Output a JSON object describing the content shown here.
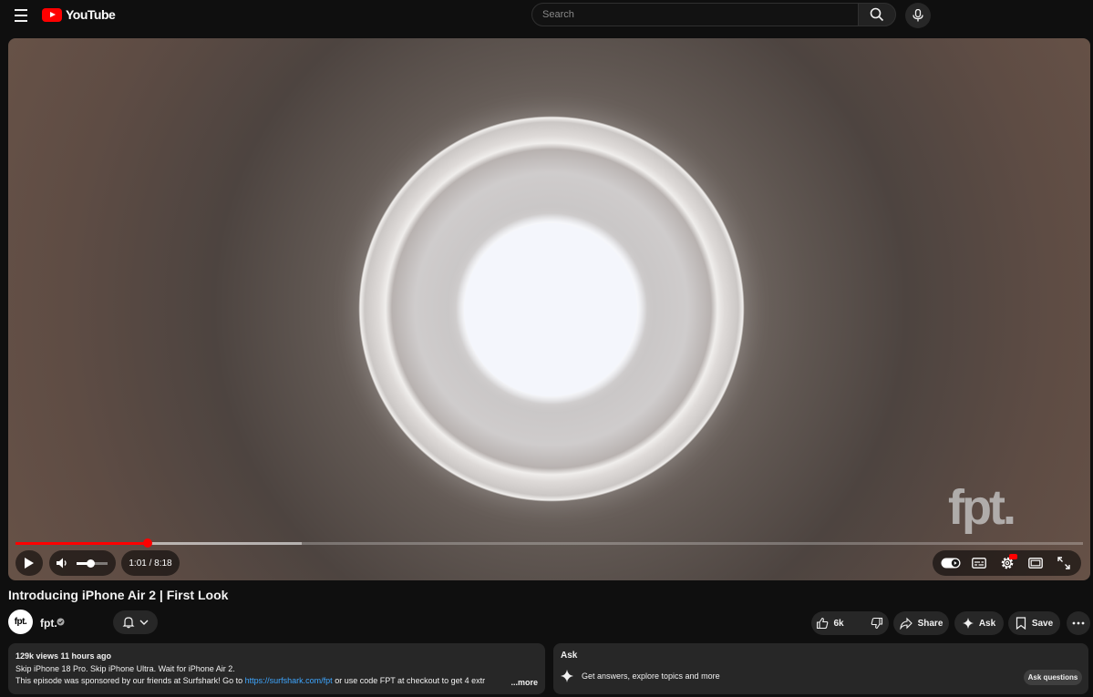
{
  "header": {
    "logo_text": "YouTube",
    "search_placeholder": "Search"
  },
  "player": {
    "watermark": "fpt.",
    "time_display": "1:01 / 8:18",
    "current_time": "1:01",
    "duration": "8:18",
    "played_fraction": 0.124,
    "buffered_fraction": 0.268,
    "volume_fraction": 0.45
  },
  "video": {
    "title": "Introducing iPhone Air 2 | First Look"
  },
  "channel": {
    "avatar_text": "fpt.",
    "name": "fpt."
  },
  "actions": {
    "like_count": "6k",
    "share_label": "Share",
    "ask_label": "Ask",
    "save_label": "Save"
  },
  "description": {
    "meta": "129k views  11 hours ago",
    "line1": "Skip iPhone 18 Pro. Skip iPhone Ultra. Wait for iPhone Air 2.",
    "line2_prefix": "This episode was sponsored by our friends at Surfshark! Go to ",
    "link": "https://surfshark.com/fpt",
    "line2_suffix": " or use code FPT at checkout to get 4 extr",
    "more_label": "...more"
  },
  "ask_panel": {
    "title": "Ask",
    "prompt": "Get answers, explore topics and more",
    "button_label": "Ask questions"
  },
  "colors": {
    "background": "#0f0f0f",
    "accent_red": "#ff0000",
    "link_blue": "#3ea6ff",
    "chip_bg": "#272727"
  }
}
